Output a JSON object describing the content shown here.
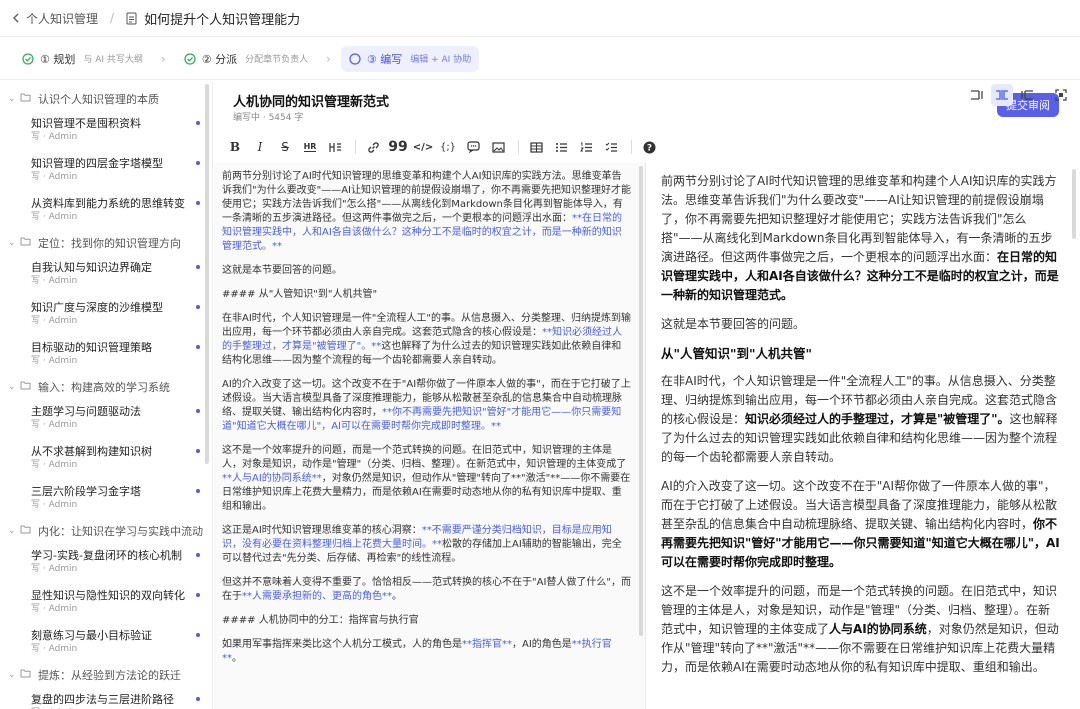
{
  "breadcrumb": {
    "parent": "个人知识管理",
    "doc": "如何提升个人知识管理能力"
  },
  "steps": [
    {
      "label": "① 规划",
      "sub": "与 AI 共写大纲",
      "state": "done"
    },
    {
      "label": "② 分派",
      "sub": "分配章节负责人",
      "state": "done"
    },
    {
      "label": "③ 编写",
      "sub": "编辑 + AI 协助",
      "state": "active"
    }
  ],
  "sidebar": {
    "sections": [
      {
        "title": "认识个人知识管理的本质",
        "items": [
          {
            "title": "知识管理不是囤积资料",
            "meta": "写 · Admin"
          },
          {
            "title": "知识管理的四层金字塔模型",
            "meta": "写 · Admin"
          },
          {
            "title": "从资料库到能力系统的思维转变",
            "meta": "写 · Admin"
          }
        ]
      },
      {
        "title": "定位：找到你的知识管理方向",
        "items": [
          {
            "title": "自我认知与知识边界确定",
            "meta": "写 · Admin"
          },
          {
            "title": "知识广度与深度的沙维模型",
            "meta": "写 · Admin"
          },
          {
            "title": "目标驱动的知识管理策略",
            "meta": "写 · Admin"
          }
        ]
      },
      {
        "title": "输入：构建高效的学习系统",
        "items": [
          {
            "title": "主题学习与问题驱动法",
            "meta": "写 · Admin"
          },
          {
            "title": "从不求甚解到构建知识树",
            "meta": "写 · Admin"
          },
          {
            "title": "三层六阶段学习金字塔",
            "meta": "写 · Admin"
          }
        ]
      },
      {
        "title": "内化：让知识在学习与实践中流动",
        "items": [
          {
            "title": "学习-实践-复盘闭环的核心机制",
            "meta": "写 · Admin"
          },
          {
            "title": "显性知识与隐性知识的双向转化",
            "meta": "写 · Admin"
          },
          {
            "title": "刻意练习与最小目标验证",
            "meta": "写 · Admin"
          }
        ]
      },
      {
        "title": "提炼：从经验到方法论的跃迁",
        "items": [
          {
            "title": "复盘的四步法与三层进阶路径",
            "meta": "写 · Admin"
          }
        ]
      }
    ]
  },
  "doc": {
    "title": "人机协同的知识管理新范式",
    "meta": "编写中 · 5454 字",
    "submit": "提交审阅"
  },
  "editor": [
    {
      "segs": [
        {
          "t": "前两节分别讨论了AI时代知识管理的思维变革和构建个人AI知识库的实践方法。思维变革告诉我们\"为什么要改变\"——AI让知识管理的前提假设崩塌了，你不再需要先把知识整理好才能使用它；实践方法告诉我们\"怎么搭\"——从离线化到Markdown条目化再到智能体导入，有一条清晰的五步演进路径。但这两件事做完之后，一个更根本的问题浮出水面："
        },
        {
          "t": "**在日常的知识管理实践中，人和AI各自该做什么？这种分工不是临时的权宜之计，而是一种新的知识管理范式。**",
          "a": true
        }
      ]
    },
    {
      "segs": [
        {
          "t": "这就是本节要回答的问题。"
        }
      ]
    },
    {
      "segs": [
        {
          "t": "#### 从\"人管知识\"到\"人机共管\""
        }
      ]
    },
    {
      "segs": [
        {
          "t": "在非AI时代，个人知识管理是一件\"全流程人工\"的事。从信息摄入、分类整理、归纳提炼到输出应用，每一个环节都必须由人亲自完成。这套范式隐含的核心假设是："
        },
        {
          "t": "**知识必须经过人的手整理过，才算是\"被管理了\"。**",
          "a": true
        },
        {
          "t": "这也解释了为什么过去的知识管理实践如此依赖自律和结构化思维——因为整个流程的每一个齿轮都需要人亲自转动。"
        }
      ]
    },
    {
      "segs": [
        {
          "t": "AI的介入改变了这一切。这个改变不在于\"AI帮你做了一件原本人做的事\"，而在于它打破了上述假设。当大语言模型具备了深度推理能力，能够从松散甚至杂乱的信息集合中自动梳理脉络、提取关键、输出结构化内容时，"
        },
        {
          "t": "**你不再需要先把知识\"管好\"才能用它——你只需要知道\"知道它大概在哪儿\"，AI可以在需要时帮你完成即时整理。**",
          "a": true
        }
      ]
    },
    {
      "segs": [
        {
          "t": "这不是一个效率提升的问题，而是一个范式转换的问题。在旧范式中，知识管理的主体是人，对象是知识，动作是\"管理\"（分类、归档、整理）。在新范式中，知识管理的主体变成了"
        },
        {
          "t": "**人与AI的协同系统**",
          "a": true
        },
        {
          "t": "，对象仍然是知识，但动作从\"管理\"转向了**\"激活\"**——你不需要在日常维护知识库上花费大量精力，而是依赖AI在需要时动态地从你的私有知识库中提取、重组和输出。"
        }
      ]
    },
    {
      "segs": [
        {
          "t": "这正是AI时代知识管理思维变革的核心洞察："
        },
        {
          "t": "**不需要严谨分类归档知识，目标是应用知识，没有必要在资料整理归档上花费大量时间。**",
          "a": true
        },
        {
          "t": "松散的存储加上AI辅助的智能输出，完全可以替代过去\"先分类、后存储、再检索\"的线性流程。"
        }
      ]
    },
    {
      "segs": [
        {
          "t": "但这并不意味着人变得不重要了。恰恰相反——范式转换的核心不在于\"AI替人做了什么\"，而在于"
        },
        {
          "t": "**人需要承担新的、更高的角色**",
          "a": true
        },
        {
          "t": "。"
        }
      ]
    },
    {
      "segs": [
        {
          "t": "#### 人机协同中的分工：指挥官与执行官"
        }
      ]
    },
    {
      "segs": [
        {
          "t": "如果用军事指挥来类比这个人机分工模式，人的角色是"
        },
        {
          "t": "**指挥官**",
          "a": true
        },
        {
          "t": "，AI的角色是"
        },
        {
          "t": "**执行官**",
          "a": true
        },
        {
          "t": "。"
        }
      ]
    }
  ],
  "preview": [
    {
      "segs": [
        {
          "t": "前两节分别讨论了AI时代知识管理的思维变革和构建个人AI知识库的实践方法。思维变革告诉我们\"为什么要改变\"——AI让知识管理的前提假设崩塌了，你不再需要先把知识整理好才能使用它；实践方法告诉我们\"怎么搭\"——从离线化到Markdown条目化再到智能体导入，有一条清晰的五步演进路径。但这两件事做完之后，一个更根本的问题浮出水面："
        },
        {
          "t": "在日常的知识管理实践中，人和AI各自该做什么？这种分工不是临时的权宜之计，而是一种新的知识管理范式。",
          "b": true
        }
      ]
    },
    {
      "segs": [
        {
          "t": "这就是本节要回答的问题。"
        }
      ]
    },
    {
      "h": true,
      "segs": [
        {
          "t": "从\"人管知识\"到\"人机共管\""
        }
      ]
    },
    {
      "segs": [
        {
          "t": "在非AI时代，个人知识管理是一件\"全流程人工\"的事。从信息摄入、分类整理、归纳提炼到输出应用，每一个环节都必须由人亲自完成。这套范式隐含的核心假设是："
        },
        {
          "t": "知识必须经过人的手整理过，才算是\"被管理了\"。",
          "b": true
        },
        {
          "t": "这也解释了为什么过去的知识管理实践如此依赖自律和结构化思维——因为整个流程的每一个齿轮都需要人亲自转动。"
        }
      ]
    },
    {
      "segs": [
        {
          "t": "AI的介入改变了这一切。这个改变不在于\"AI帮你做了一件原本人做的事\"，而在于它打破了上述假设。当大语言模型具备了深度推理能力，能够从松散甚至杂乱的信息集合中自动梳理脉络、提取关键、输出结构化内容时，"
        },
        {
          "t": "你不再需要先把知识\"管好\"才能用它——你只需要知道\"知道它大概在哪儿\"，AI可以在需要时帮你完成即时整理。",
          "b": true
        }
      ]
    },
    {
      "segs": [
        {
          "t": "这不是一个效率提升的问题，而是一个范式转换的问题。在旧范式中，知识管理的主体是人，对象是知识，动作是\"管理\"（分类、归档、整理）。在新范式中，知识管理的主体变成了"
        },
        {
          "t": "人与AI的协同系统",
          "b": true
        },
        {
          "t": "，对象仍然是知识，但动作从\"管理\"转向了**\"激活\"**——你不需要在日常维护知识库上花费大量精力，而是依赖AI在需要时动态地从你的私有知识库中提取、重组和输出。"
        }
      ]
    }
  ],
  "toolbar_icons": [
    "bold-icon",
    "italic-icon",
    "strikethrough-icon",
    "horizontal-rule-icon",
    "heading-icon",
    "link-icon",
    "quote-icon",
    "code-icon",
    "code-block-icon",
    "comment-icon",
    "image-icon",
    "table-icon",
    "bullet-list-icon",
    "ordered-list-icon",
    "task-list-icon",
    "help-icon"
  ],
  "colors": {
    "accent": "#5a5fe8",
    "link": "#4a5fe0",
    "done": "#35b05a"
  }
}
